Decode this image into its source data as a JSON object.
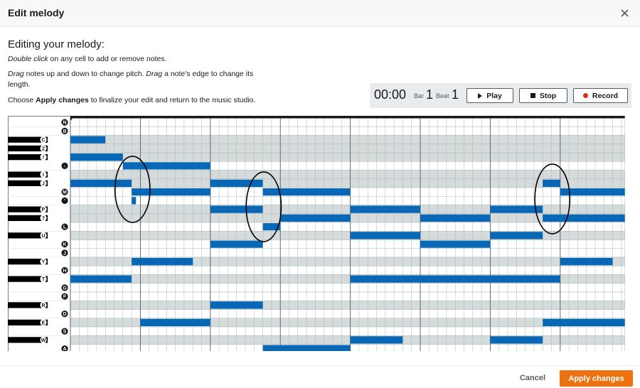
{
  "modal": {
    "title": "Edit melody",
    "close_icon": "close-icon"
  },
  "instructions": {
    "heading": "Editing your melody:",
    "line1": {
      "em": "Double click",
      "rest": " on any cell to add or remove notes."
    },
    "line2": {
      "em1": "Drag",
      "mid": " notes up and down to change pitch. ",
      "em2": "Drag",
      "rest": " a note's edge to change its length."
    },
    "line3": {
      "pre": "Choose ",
      "strong": "Apply changes",
      "rest": " to finalize your edit and return to the music studio."
    }
  },
  "transport": {
    "time": "00:00",
    "bar_label": "Bar",
    "bar_value": "1",
    "beat_label": "Beat",
    "beat_value": "1",
    "play_label": "Play",
    "stop_label": "Stop",
    "record_label": "Record",
    "record_color": "#d13212"
  },
  "piano_roll": {
    "keys": [
      "N",
      "B",
      "C",
      "Z",
      "/",
      "-",
      "I",
      "J",
      "M",
      "'",
      "P",
      "7",
      "L",
      "U",
      "K",
      "J",
      "Y",
      "H",
      "T",
      "G",
      "F",
      "R",
      "D",
      "E",
      "S",
      "W",
      "A"
    ],
    "black_keys": [
      2,
      3,
      4,
      6,
      7,
      10,
      11,
      13,
      16,
      18,
      21,
      23,
      25
    ],
    "notes": [
      {
        "row": 2,
        "start": 0,
        "len": 4
      },
      {
        "row": 4,
        "start": 0,
        "len": 6
      },
      {
        "row": 5,
        "start": 6,
        "len": 10
      },
      {
        "row": 7,
        "start": 0,
        "len": 7
      },
      {
        "row": 7,
        "start": 16,
        "len": 6
      },
      {
        "row": 7,
        "start": 54,
        "len": 2
      },
      {
        "row": 8,
        "start": 7,
        "len": 9
      },
      {
        "row": 8,
        "start": 22,
        "len": 10
      },
      {
        "row": 8,
        "start": 56,
        "len": 8
      },
      {
        "row": 9,
        "start": 7,
        "len": 0.5
      },
      {
        "row": 10,
        "start": 16,
        "len": 6
      },
      {
        "row": 10,
        "start": 32,
        "len": 8
      },
      {
        "row": 10,
        "start": 48,
        "len": 6
      },
      {
        "row": 11,
        "start": 24,
        "len": 8
      },
      {
        "row": 11,
        "start": 40,
        "len": 8
      },
      {
        "row": 11,
        "start": 54,
        "len": 10
      },
      {
        "row": 12,
        "start": 22,
        "len": 2
      },
      {
        "row": 13,
        "start": 32,
        "len": 8
      },
      {
        "row": 13,
        "start": 48,
        "len": 6
      },
      {
        "row": 14,
        "start": 16,
        "len": 6
      },
      {
        "row": 14,
        "start": 40,
        "len": 8
      },
      {
        "row": 16,
        "start": 7,
        "len": 7
      },
      {
        "row": 16,
        "start": 56,
        "len": 6
      },
      {
        "row": 18,
        "start": 0,
        "len": 7
      },
      {
        "row": 18,
        "start": 32,
        "len": 24
      },
      {
        "row": 21,
        "start": 16,
        "len": 6
      },
      {
        "row": 23,
        "start": 8,
        "len": 8
      },
      {
        "row": 23,
        "start": 54,
        "len": 10
      },
      {
        "row": 25,
        "start": 32,
        "len": 6
      },
      {
        "row": 25,
        "start": 48,
        "len": 6
      },
      {
        "row": 26,
        "start": 22,
        "len": 10
      }
    ],
    "note_color": "#0968b6",
    "circles": [
      {
        "cx_col": 7.1,
        "cy_row": 8.2,
        "rx_cols": 2.0,
        "ry_rows": 3.8
      },
      {
        "cx_col": 22.1,
        "cy_row": 10.2,
        "rx_cols": 2.0,
        "ry_rows": 4.0
      },
      {
        "cx_col": 55.1,
        "cy_row": 9.3,
        "rx_cols": 2.0,
        "ry_rows": 4.0
      }
    ]
  },
  "footer": {
    "cancel_label": "Cancel",
    "apply_label": "Apply changes",
    "apply_color": "#ec7211"
  }
}
